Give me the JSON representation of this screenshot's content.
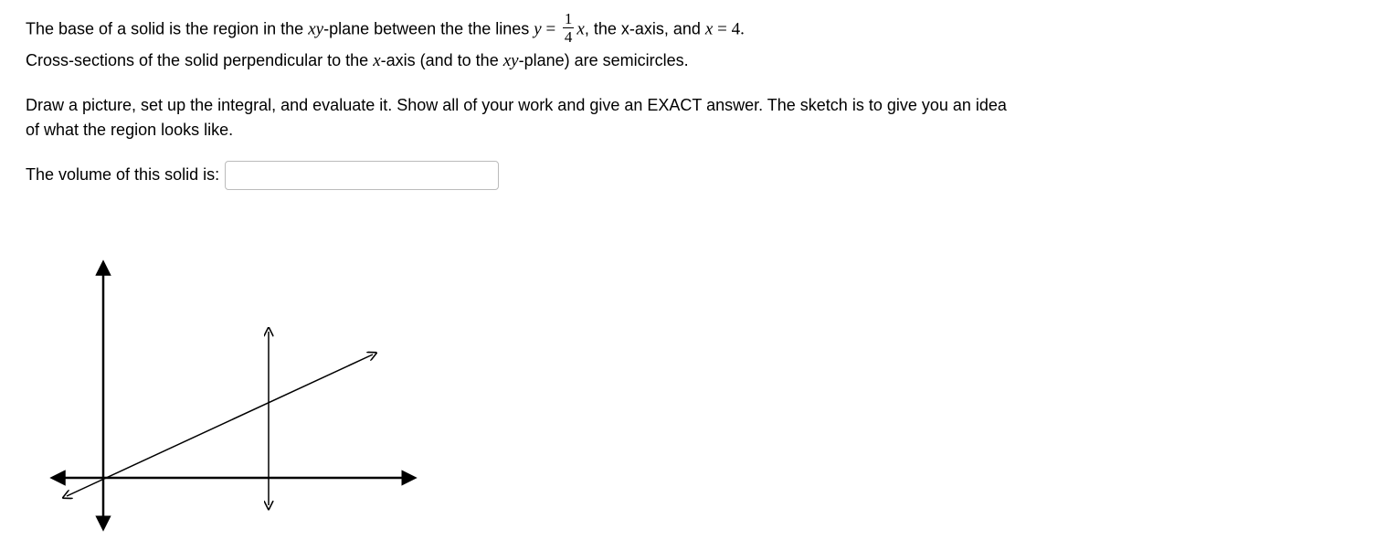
{
  "problem": {
    "line1_parts": {
      "a": "The base of a solid is the region in the ",
      "xy1": "xy",
      "b": "-plane between the the lines ",
      "y": "y",
      "eq1": " = ",
      "frac_num": "1",
      "frac_den": "4",
      "x1": "x",
      "c": ", the x-axis, and ",
      "x2": "x",
      "eq2": " = ",
      "four": "4.",
      "d": ""
    },
    "line2_parts": {
      "a": "Cross-sections of the solid perpendicular to the ",
      "x": "x",
      "b": "-axis (and to the ",
      "xy": "xy",
      "c": "-plane) are semicircles."
    },
    "instructions": "Draw a picture, set up the integral, and evaluate it. Show all of your work and give an EXACT answer.  The sketch is to give you an idea of what the region looks like.",
    "answer_label": "The volume of this solid is:",
    "answer_value": ""
  }
}
